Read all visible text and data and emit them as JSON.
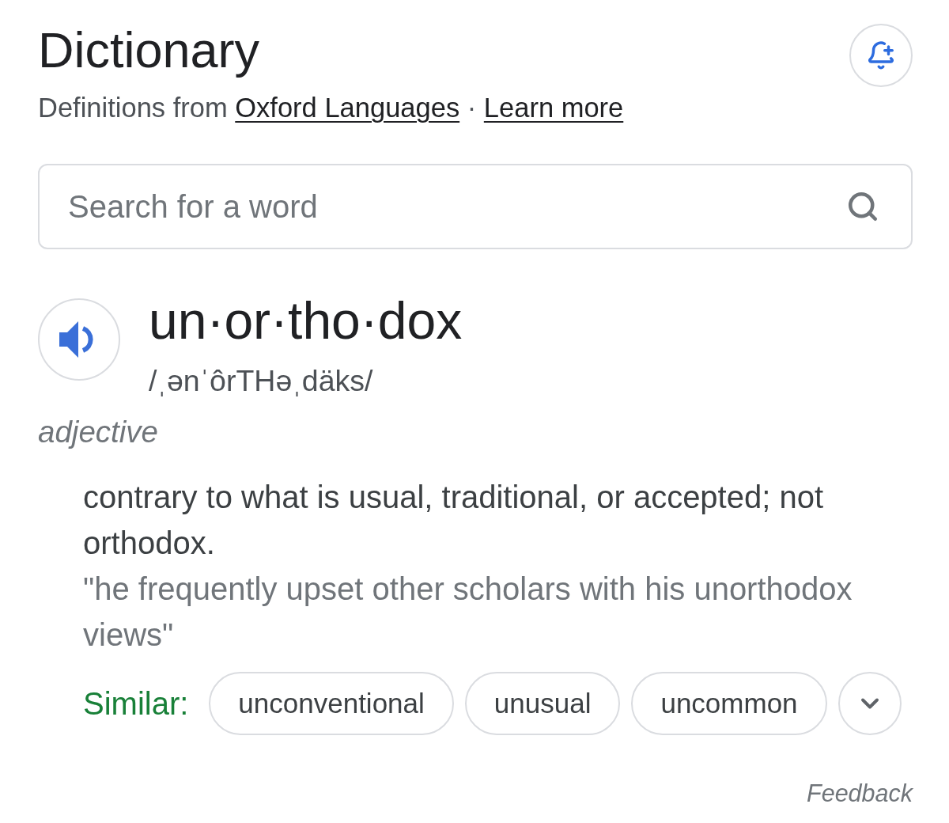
{
  "header": {
    "title": "Dictionary",
    "subtitle": {
      "prefix": "Definitions from",
      "source_link": "Oxford Languages",
      "separator": "·",
      "learn_more_link": "Learn more"
    }
  },
  "search": {
    "placeholder": "Search for a word"
  },
  "entry": {
    "headword": "un·or·tho·dox",
    "pronunciation": "/ˌənˈôrTHəˌdäks/",
    "part_of_speech": "adjective",
    "definitions": [
      {
        "text": "contrary to what is usual, traditional, or accepted; not orthodox.",
        "example": "\"he frequently upset other scholars with his unorthodox views\"",
        "similar_label": "Similar:",
        "similar": [
          "unconventional",
          "unusual",
          "uncommon"
        ]
      }
    ]
  },
  "feedback": "Feedback"
}
